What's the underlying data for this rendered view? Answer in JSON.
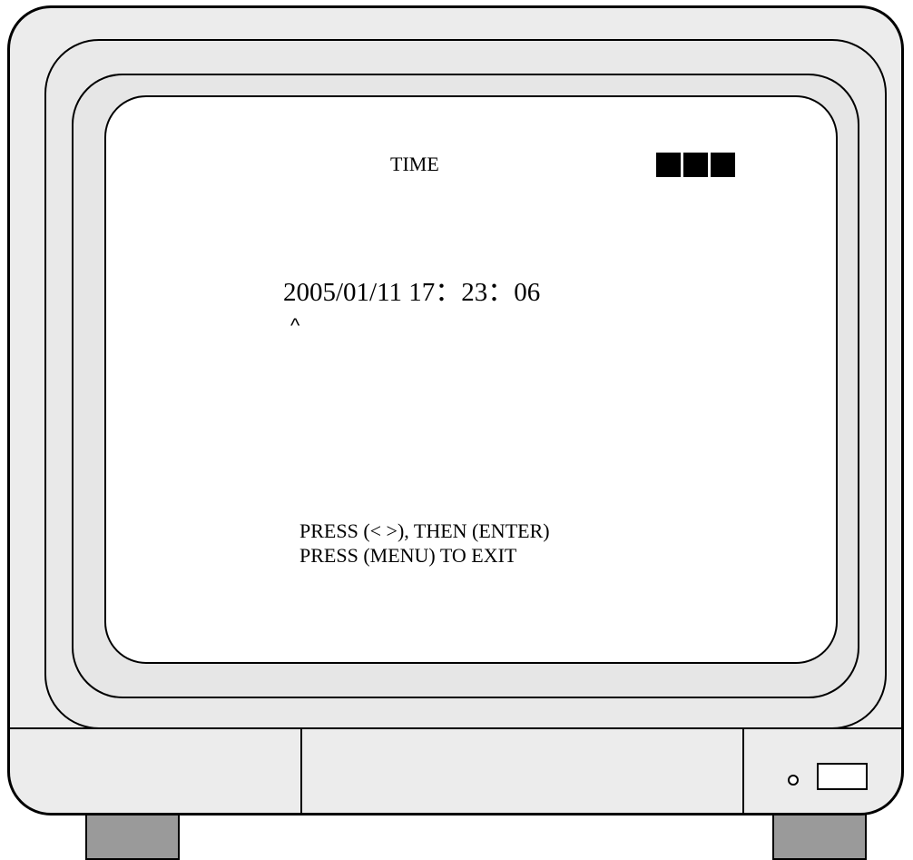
{
  "osd": {
    "title": "TIME",
    "signal_indicator_blocks": 3,
    "datetime": "2005/01/11 17：23：06",
    "cursor": "^",
    "help_lines": [
      "PRESS (< >), THEN (ENTER)",
      "PRESS (MENU) TO EXIT"
    ]
  },
  "colors": {
    "cabinet": "#ececec",
    "screen": "#ffffff",
    "text": "#000000",
    "foot": "#9a9a9a"
  },
  "icons": {
    "led": "power-led-icon",
    "power_button": "power-button-icon"
  }
}
